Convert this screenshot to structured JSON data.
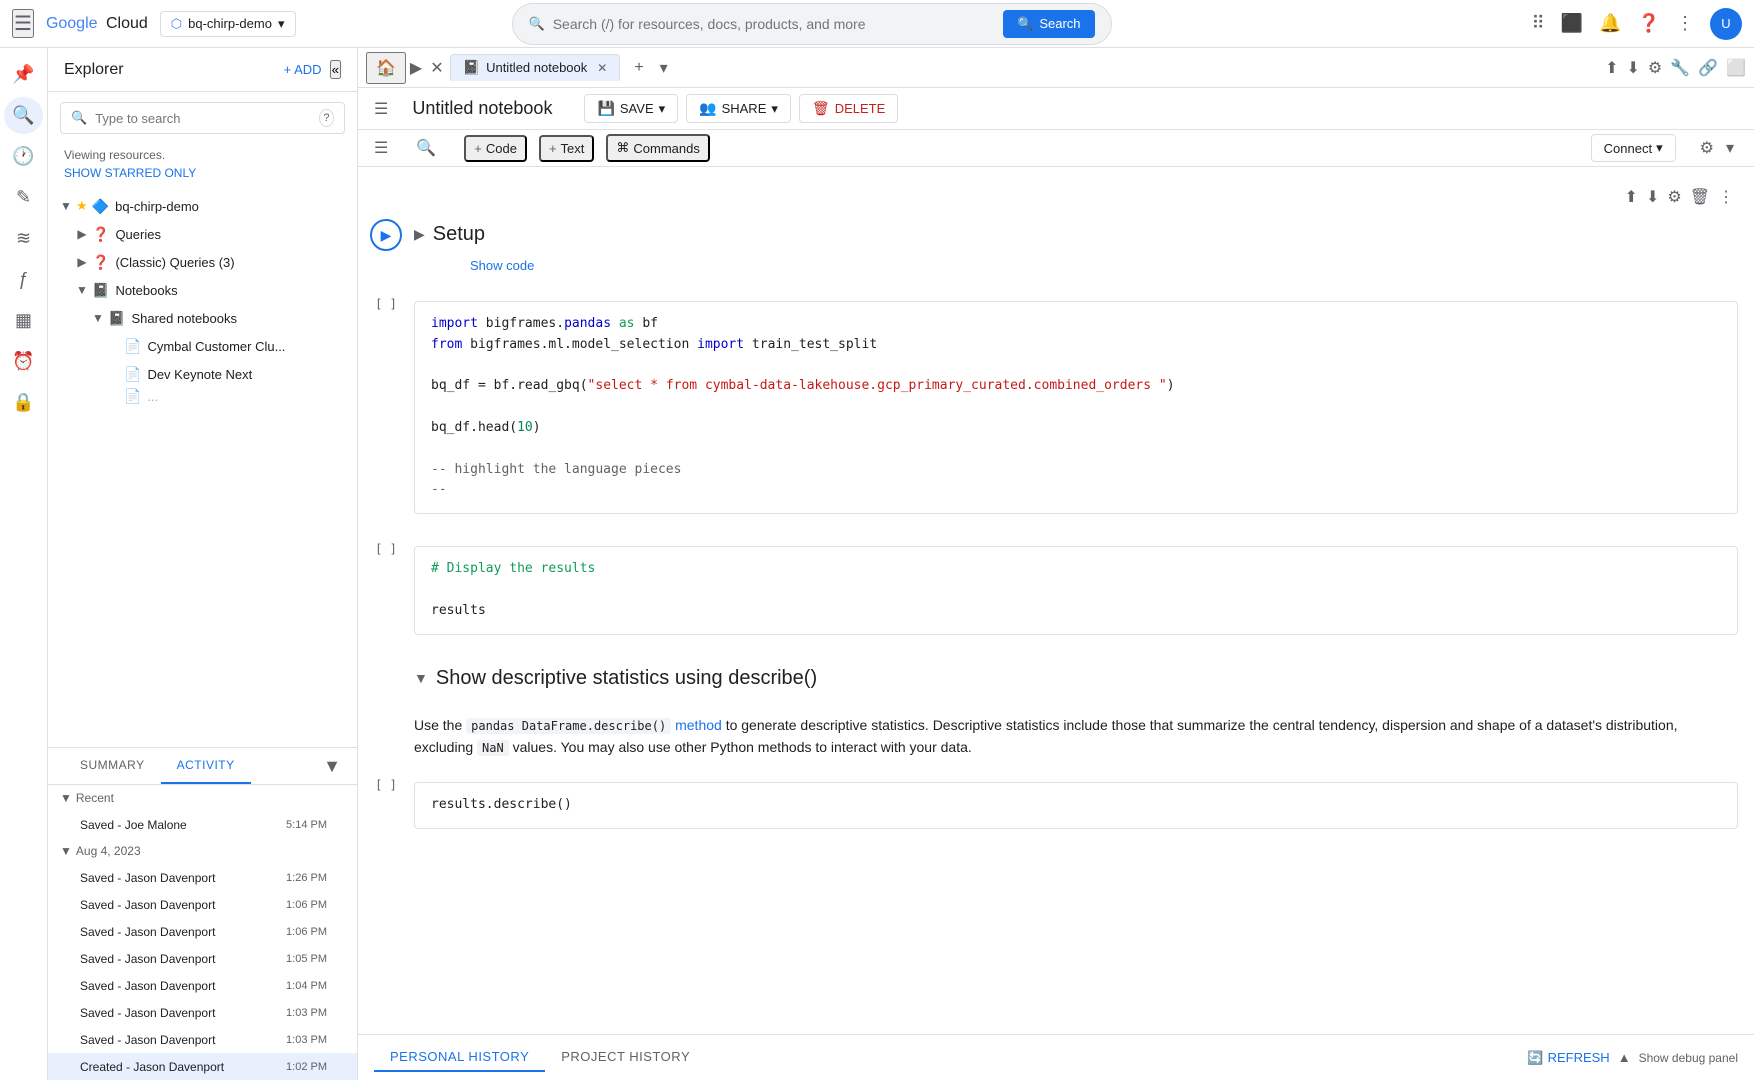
{
  "topNav": {
    "hamburger": "☰",
    "logoGoogle": "Google",
    "logoCloud": "Cloud",
    "projectLabel": "bq-chirp-demo",
    "searchPlaceholder": "Search (/) for resources, docs, products, and more",
    "searchBtn": "Search"
  },
  "explorer": {
    "title": "Explorer",
    "addLabel": "+ ADD",
    "searchPlaceholder": "Type to search",
    "helpIcon": "?",
    "viewingInfo": "Viewing resources.",
    "showStarredLabel": "SHOW STARRED ONLY",
    "collapseIcon": "«",
    "tree": [
      {
        "id": "bq-chirp-demo",
        "label": "bq-chirp-demo",
        "level": 0,
        "expandable": true,
        "expanded": true,
        "icon": "🔷",
        "starred": true
      },
      {
        "id": "queries",
        "label": "Queries",
        "level": 1,
        "expandable": true,
        "expanded": false,
        "icon": "❓"
      },
      {
        "id": "classic-queries",
        "label": "(Classic) Queries (3)",
        "level": 1,
        "expandable": true,
        "expanded": false,
        "icon": "❓"
      },
      {
        "id": "notebooks",
        "label": "Notebooks",
        "level": 1,
        "expandable": true,
        "expanded": true,
        "icon": "📓"
      },
      {
        "id": "shared-notebooks",
        "label": "Shared notebooks",
        "level": 2,
        "expandable": true,
        "expanded": true,
        "icon": "📓"
      },
      {
        "id": "cymbal",
        "label": "Cymbal Customer Clu...",
        "level": 3,
        "expandable": false,
        "icon": "📄"
      },
      {
        "id": "dev-keynote",
        "label": "Dev Keynote Next",
        "level": 3,
        "expandable": false,
        "icon": "📄"
      }
    ]
  },
  "bottomTabs": {
    "summary": "SUMMARY",
    "activity": "ACTIVITY",
    "activeTab": "ACTIVITY",
    "collapseIcon": "▼"
  },
  "activityPanel": {
    "recentLabel": "Recent",
    "recentItems": [
      {
        "label": "Saved - Joe Malone",
        "time": "5:14 PM"
      }
    ],
    "aug4Label": "Aug 4, 2023",
    "aug4Items": [
      {
        "label": "Saved - Jason Davenport",
        "time": "1:26 PM"
      },
      {
        "label": "Saved - Jason Davenport",
        "time": "1:06 PM"
      },
      {
        "label": "Saved - Jason Davenport",
        "time": "1:06 PM"
      },
      {
        "label": "Saved - Jason Davenport",
        "time": "1:05 PM"
      },
      {
        "label": "Saved - Jason Davenport",
        "time": "1:04 PM"
      },
      {
        "label": "Saved - Jason Davenport",
        "time": "1:03 PM"
      },
      {
        "label": "Saved - Jason Davenport",
        "time": "1:03 PM"
      },
      {
        "label": "Created - Jason Davenport",
        "time": "1:02 PM",
        "highlighted": true
      }
    ]
  },
  "notebookTabs": {
    "homeIcon": "🏠",
    "tabs": [
      {
        "id": "untitled",
        "label": "Untitled notebook",
        "icon": "📓",
        "active": true,
        "closable": true
      }
    ],
    "addTabIcon": "+",
    "rightIcons": [
      "⬆",
      "⬇",
      "⚙",
      "🔧",
      "🔗",
      "⬜"
    ]
  },
  "toolbar": {
    "title": "Untitled notebook",
    "save": "SAVE",
    "share": "SHARE",
    "delete": "DELETE",
    "saveIcon": "💾",
    "shareIcon": "👥",
    "deleteIcon": "🗑"
  },
  "cellToolbar": {
    "codeLabel": "+ Code",
    "textLabel": "+ Text",
    "commandsLabel": "Commands",
    "connectLabel": "Connect",
    "connectDropdownIcon": "▾",
    "settingsIcon": "⚙",
    "chevronIcon": "▾"
  },
  "cells": [
    {
      "id": "setup",
      "type": "section",
      "title": "Setup",
      "expanded": true,
      "showCode": true
    },
    {
      "id": "code1",
      "type": "code",
      "brackets": "[ ]",
      "lines": [
        {
          "type": "import",
          "text": "import bigframes.pandas as bf"
        },
        {
          "type": "import",
          "text": "from bigframes.ml.model_selection import train_test_split"
        },
        {
          "type": "blank"
        },
        {
          "type": "assign",
          "text": "bq_df = bf.read_gbq(\"select * from cymbal-data-lakehouse.gcp_primary_curated.combined_orders \")"
        },
        {
          "type": "blank"
        },
        {
          "type": "call",
          "text": "bq_df.head(10)"
        },
        {
          "type": "blank"
        },
        {
          "type": "comment",
          "text": "-- highlight the language pieces"
        },
        {
          "type": "comment",
          "text": "--"
        }
      ]
    },
    {
      "id": "code2",
      "type": "code",
      "brackets": "[ ]",
      "lines": [
        {
          "type": "comment2",
          "text": "# Display the results"
        },
        {
          "type": "blank"
        },
        {
          "type": "plain",
          "text": "results"
        }
      ]
    },
    {
      "id": "section2",
      "type": "section",
      "title": "Show descriptive statistics using describe()",
      "expanded": true
    },
    {
      "id": "text1",
      "type": "text",
      "html": true,
      "content": "Use the <code>pandas DataFrame.describe()</code> <a href='#'>method</a> to generate descriptive statistics. Descriptive statistics include those that summarize the central tendency, dispersion and shape of a dataset's distribution, excluding <code>NaN</code> values. You may also use other Python methods to interact with your data."
    },
    {
      "id": "code3",
      "type": "code",
      "brackets": "[ ]",
      "lines": [
        {
          "type": "plain",
          "text": "results.describe()"
        }
      ]
    }
  ],
  "statusBar": {
    "personalHistory": "PERSONAL HISTORY",
    "projectHistory": "PROJECT HISTORY",
    "refreshLabel": "REFRESH",
    "debugLabel": "Show debug panel",
    "refreshIcon": "🔄",
    "chevronUp": "▲"
  }
}
